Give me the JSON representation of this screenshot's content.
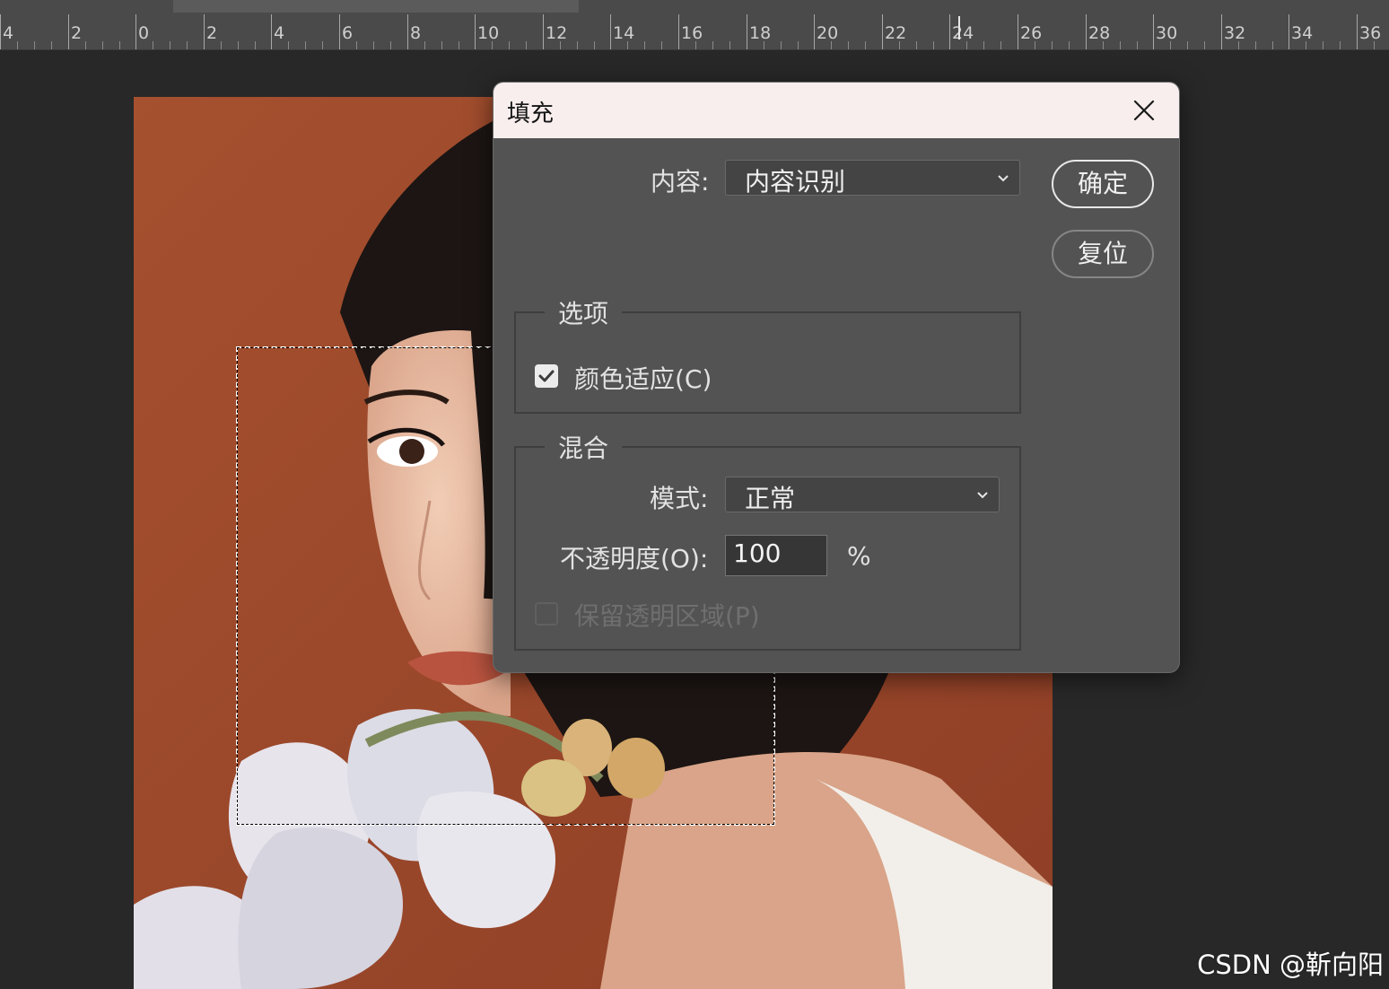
{
  "ruler": {
    "labels": [
      "4",
      "2",
      "0",
      "2",
      "4",
      "6",
      "8",
      "10",
      "12",
      "14",
      "16",
      "18",
      "20",
      "22",
      "24",
      "26",
      "28",
      "30",
      "32",
      "34",
      "36"
    ]
  },
  "dialog": {
    "title": "填充",
    "content_label": "内容:",
    "content_value": "内容识别",
    "ok_label": "确定",
    "reset_label": "复位",
    "options_group": {
      "legend": "选项",
      "color_adapt_label": "颜色适应(C)",
      "color_adapt_checked": true
    },
    "blend_group": {
      "legend": "混合",
      "mode_label": "模式:",
      "mode_value": "正常",
      "opacity_label": "不透明度(O):",
      "opacity_value": "100",
      "opacity_unit": "%",
      "preserve_label": "保留透明区域(P)",
      "preserve_checked": false,
      "preserve_enabled": false
    }
  },
  "watermark": "CSDN @靳向阳",
  "colors": {
    "photo_background": "#a04a2f",
    "dialog_bg": "#535353",
    "titlebar_bg": "#f8eeee"
  }
}
